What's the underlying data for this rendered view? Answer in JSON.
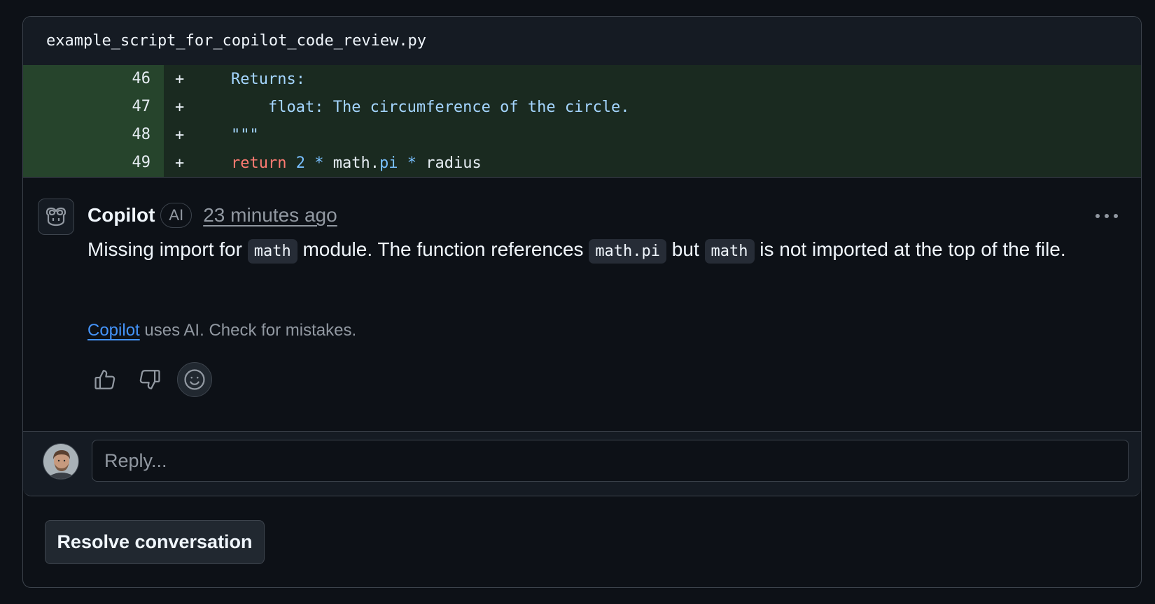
{
  "file": {
    "name": "example_script_for_copilot_code_review.py"
  },
  "diff": {
    "sign": "+",
    "lines": [
      {
        "number": "46",
        "indent": "",
        "tokens": [
          {
            "t": "Returns:",
            "c": "str"
          }
        ]
      },
      {
        "number": "47",
        "indent": "    ",
        "tokens": [
          {
            "t": "float: The circumference of the circle.",
            "c": "str"
          }
        ]
      },
      {
        "number": "48",
        "indent": "",
        "tokens": [
          {
            "t": "\"\"\"",
            "c": "str"
          }
        ]
      },
      {
        "number": "49",
        "indent": "",
        "tokens": [
          {
            "t": "return",
            "c": "kw"
          },
          {
            "t": " ",
            "c": "id"
          },
          {
            "t": "2",
            "c": "num"
          },
          {
            "t": " ",
            "c": "id"
          },
          {
            "t": "*",
            "c": "op"
          },
          {
            "t": " math.",
            "c": "id"
          },
          {
            "t": "pi",
            "c": "attr"
          },
          {
            "t": " ",
            "c": "id"
          },
          {
            "t": "*",
            "c": "op"
          },
          {
            "t": " radius",
            "c": "id"
          }
        ]
      }
    ]
  },
  "comment": {
    "author": "Copilot",
    "badge": "AI",
    "timestamp": "23 minutes ago",
    "more_icon": "kebab-horizontal-icon",
    "body": {
      "part1": "Missing import for ",
      "code1": "math",
      "part2": " module. The function references ",
      "code2": "math.pi",
      "part3": " but ",
      "code3": "math",
      "part4": " is not imported at the top of the file."
    },
    "disclaimer": {
      "link": "Copilot",
      "text": " uses AI. Check for mistakes."
    },
    "reactions": [
      "thumbs-up-icon",
      "thumbs-down-icon",
      "smiley-icon"
    ]
  },
  "reply": {
    "placeholder": "Reply..."
  },
  "actions": {
    "resolve_label": "Resolve conversation"
  },
  "colors": {
    "background": "#0d1117",
    "border": "#3d444d",
    "diff_line_number_bg": "#26442c",
    "diff_code_bg": "#1a2a20",
    "string": "#a5d6ff",
    "keyword": "#ff7b72",
    "constant": "#79c0ff",
    "link": "#4493f8",
    "muted": "#9198a1"
  }
}
